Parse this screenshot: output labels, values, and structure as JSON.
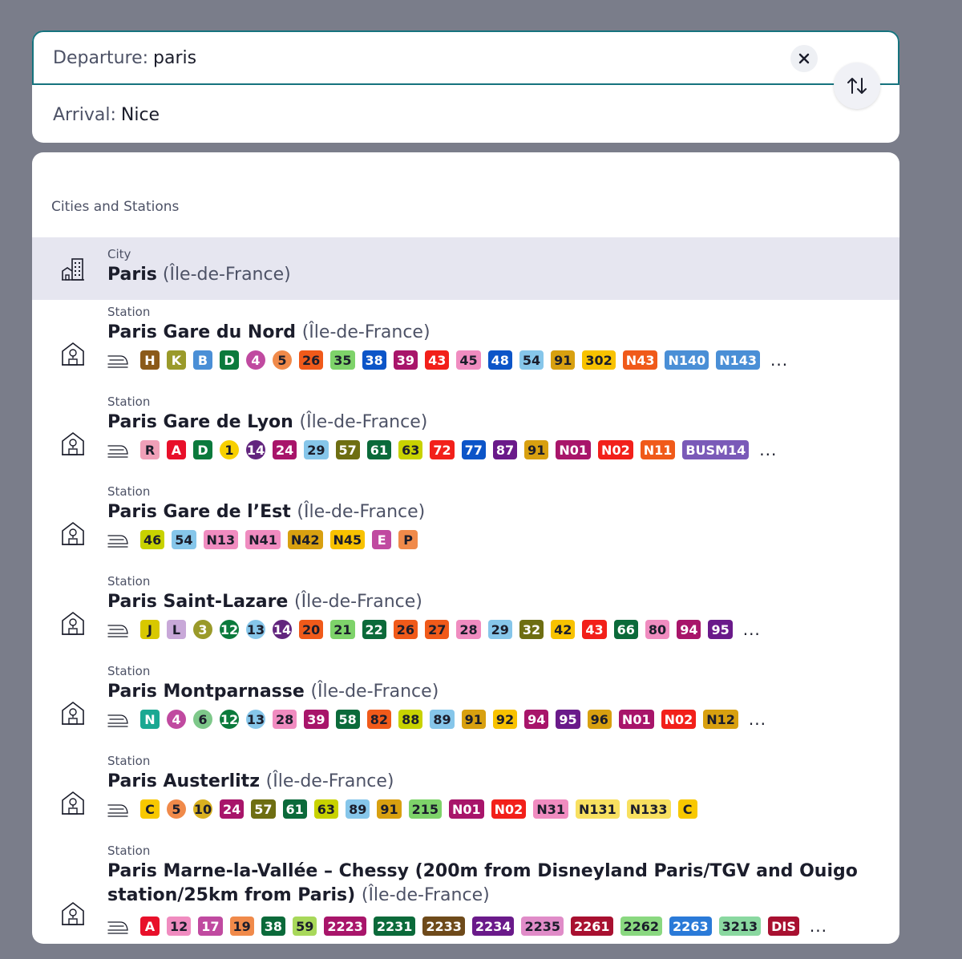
{
  "search": {
    "departure_label": "Departure:",
    "departure_value": "paris",
    "arrival_label": "Arrival:",
    "arrival_value": "Nice",
    "clear_icon": "close-icon",
    "swap_icon": "swap-vertical-icon"
  },
  "results": {
    "section_title": "Cities and Stations",
    "city": {
      "type": "City",
      "name": "Paris",
      "region": "(Île-de-France)",
      "icon": "city-icon"
    },
    "stations": [
      {
        "type": "Station",
        "name": "Paris Gare du Nord",
        "region": "(Île-de-France)",
        "more": "...",
        "lines": [
          {
            "t": "H",
            "bg": "#8b5a1a",
            "fg": "#ffffff"
          },
          {
            "t": "K",
            "bg": "#9a9a2a",
            "fg": "#ffffff"
          },
          {
            "t": "B",
            "bg": "#4a8fd6",
            "fg": "#ffffff"
          },
          {
            "t": "D",
            "bg": "#0b7a3c",
            "fg": "#ffffff"
          },
          {
            "t": "4",
            "bg": "#c04aa0",
            "fg": "#ffffff",
            "shape": "circle"
          },
          {
            "t": "5",
            "bg": "#f08a4a",
            "fg": "#1b1d2b",
            "shape": "circle"
          },
          {
            "t": "26",
            "bg": "#f05a1a",
            "fg": "#1b1d2b"
          },
          {
            "t": "35",
            "bg": "#7ed36a",
            "fg": "#1b1d2b"
          },
          {
            "t": "38",
            "bg": "#0c55c8",
            "fg": "#ffffff"
          },
          {
            "t": "39",
            "bg": "#a8156a",
            "fg": "#ffffff"
          },
          {
            "t": "43",
            "bg": "#f2201a",
            "fg": "#ffffff"
          },
          {
            "t": "45",
            "bg": "#f08cc0",
            "fg": "#1b1d2b"
          },
          {
            "t": "48",
            "bg": "#0c55c8",
            "fg": "#ffffff"
          },
          {
            "t": "54",
            "bg": "#86c6ea",
            "fg": "#1b1d2b"
          },
          {
            "t": "91",
            "bg": "#d8a010",
            "fg": "#1b1d2b"
          },
          {
            "t": "302",
            "bg": "#f8c200",
            "fg": "#1b1d2b"
          },
          {
            "t": "N43",
            "bg": "#f05a1a",
            "fg": "#ffffff"
          },
          {
            "t": "N140",
            "bg": "#4a8fd6",
            "fg": "#ffffff"
          },
          {
            "t": "N143",
            "bg": "#4a8fd6",
            "fg": "#ffffff"
          }
        ]
      },
      {
        "type": "Station",
        "name": "Paris Gare de Lyon",
        "region": "(Île-de-France)",
        "more": "...",
        "lines": [
          {
            "t": "R",
            "bg": "#f0a0b8",
            "fg": "#1b1d2b"
          },
          {
            "t": "A",
            "bg": "#e8102a",
            "fg": "#ffffff"
          },
          {
            "t": "D",
            "bg": "#0b7a3c",
            "fg": "#ffffff"
          },
          {
            "t": "1",
            "bg": "#f8d000",
            "fg": "#1b1d2b",
            "shape": "circle"
          },
          {
            "t": "14",
            "bg": "#62257e",
            "fg": "#ffffff",
            "shape": "circle"
          },
          {
            "t": "24",
            "bg": "#a8156a",
            "fg": "#ffffff"
          },
          {
            "t": "29",
            "bg": "#86c6ea",
            "fg": "#1b1d2b"
          },
          {
            "t": "57",
            "bg": "#6e6e12",
            "fg": "#ffffff"
          },
          {
            "t": "61",
            "bg": "#0b6a3a",
            "fg": "#ffffff"
          },
          {
            "t": "63",
            "bg": "#c8d200",
            "fg": "#1b1d2b"
          },
          {
            "t": "72",
            "bg": "#f2201a",
            "fg": "#ffffff"
          },
          {
            "t": "77",
            "bg": "#0c55c8",
            "fg": "#ffffff"
          },
          {
            "t": "87",
            "bg": "#6a1a8a",
            "fg": "#ffffff"
          },
          {
            "t": "91",
            "bg": "#d8a010",
            "fg": "#1b1d2b"
          },
          {
            "t": "N01",
            "bg": "#a8156a",
            "fg": "#ffffff"
          },
          {
            "t": "N02",
            "bg": "#f2201a",
            "fg": "#ffffff"
          },
          {
            "t": "N11",
            "bg": "#f05a1a",
            "fg": "#ffffff"
          },
          {
            "t": "BUSM14",
            "bg": "#7a5ab8",
            "fg": "#ffffff"
          }
        ]
      },
      {
        "type": "Station",
        "name": "Paris Gare de l’Est",
        "region": "(Île-de-France)",
        "more": "",
        "lines": [
          {
            "t": "46",
            "bg": "#c8d200",
            "fg": "#1b1d2b"
          },
          {
            "t": "54",
            "bg": "#86c6ea",
            "fg": "#1b1d2b"
          },
          {
            "t": "N13",
            "bg": "#f08cc0",
            "fg": "#1b1d2b"
          },
          {
            "t": "N41",
            "bg": "#f08cc0",
            "fg": "#1b1d2b"
          },
          {
            "t": "N42",
            "bg": "#d8a010",
            "fg": "#1b1d2b"
          },
          {
            "t": "N45",
            "bg": "#f8c200",
            "fg": "#1b1d2b"
          },
          {
            "t": "E",
            "bg": "#c04aa0",
            "fg": "#ffffff"
          },
          {
            "t": "P",
            "bg": "#f08a4a",
            "fg": "#1b1d2b"
          }
        ]
      },
      {
        "type": "Station",
        "name": "Paris Saint-Lazare",
        "region": "(Île-de-France)",
        "more": "...",
        "lines": [
          {
            "t": "J",
            "bg": "#d8c800",
            "fg": "#1b1d2b"
          },
          {
            "t": "L",
            "bg": "#c8a8d8",
            "fg": "#1b1d2b"
          },
          {
            "t": "3",
            "bg": "#9a9a2a",
            "fg": "#ffffff",
            "shape": "circle"
          },
          {
            "t": "12",
            "bg": "#0b7a3c",
            "fg": "#ffffff",
            "shape": "circle"
          },
          {
            "t": "13",
            "bg": "#86c6ea",
            "fg": "#1b1d2b",
            "shape": "circle"
          },
          {
            "t": "14",
            "bg": "#62257e",
            "fg": "#ffffff",
            "shape": "circle"
          },
          {
            "t": "20",
            "bg": "#f05a1a",
            "fg": "#1b1d2b"
          },
          {
            "t": "21",
            "bg": "#7ed36a",
            "fg": "#1b1d2b"
          },
          {
            "t": "22",
            "bg": "#0b6a3a",
            "fg": "#ffffff"
          },
          {
            "t": "26",
            "bg": "#f05a1a",
            "fg": "#1b1d2b"
          },
          {
            "t": "27",
            "bg": "#f05a1a",
            "fg": "#1b1d2b"
          },
          {
            "t": "28",
            "bg": "#f08cc0",
            "fg": "#1b1d2b"
          },
          {
            "t": "29",
            "bg": "#86c6ea",
            "fg": "#1b1d2b"
          },
          {
            "t": "32",
            "bg": "#6e6e12",
            "fg": "#ffffff"
          },
          {
            "t": "42",
            "bg": "#f8c200",
            "fg": "#1b1d2b"
          },
          {
            "t": "43",
            "bg": "#f2201a",
            "fg": "#ffffff"
          },
          {
            "t": "66",
            "bg": "#0b6a3a",
            "fg": "#ffffff"
          },
          {
            "t": "80",
            "bg": "#f08cc0",
            "fg": "#1b1d2b"
          },
          {
            "t": "94",
            "bg": "#a8156a",
            "fg": "#ffffff"
          },
          {
            "t": "95",
            "bg": "#6a1a8a",
            "fg": "#ffffff"
          }
        ]
      },
      {
        "type": "Station",
        "name": "Paris Montparnasse",
        "region": "(Île-de-France)",
        "more": "...",
        "lines": [
          {
            "t": "N",
            "bg": "#1aa892",
            "fg": "#ffffff"
          },
          {
            "t": "4",
            "bg": "#c04aa0",
            "fg": "#ffffff",
            "shape": "circle"
          },
          {
            "t": "6",
            "bg": "#7ec88a",
            "fg": "#1b1d2b",
            "shape": "circle"
          },
          {
            "t": "12",
            "bg": "#0b7a3c",
            "fg": "#ffffff",
            "shape": "circle"
          },
          {
            "t": "13",
            "bg": "#86c6ea",
            "fg": "#1b1d2b",
            "shape": "circle"
          },
          {
            "t": "28",
            "bg": "#f08cc0",
            "fg": "#1b1d2b"
          },
          {
            "t": "39",
            "bg": "#a8156a",
            "fg": "#ffffff"
          },
          {
            "t": "58",
            "bg": "#0b6a3a",
            "fg": "#ffffff"
          },
          {
            "t": "82",
            "bg": "#f05a1a",
            "fg": "#1b1d2b"
          },
          {
            "t": "88",
            "bg": "#c8d200",
            "fg": "#1b1d2b"
          },
          {
            "t": "89",
            "bg": "#86c6ea",
            "fg": "#1b1d2b"
          },
          {
            "t": "91",
            "bg": "#d8a010",
            "fg": "#1b1d2b"
          },
          {
            "t": "92",
            "bg": "#f8c200",
            "fg": "#1b1d2b"
          },
          {
            "t": "94",
            "bg": "#a8156a",
            "fg": "#ffffff"
          },
          {
            "t": "95",
            "bg": "#6a1a8a",
            "fg": "#ffffff"
          },
          {
            "t": "96",
            "bg": "#d8a010",
            "fg": "#1b1d2b"
          },
          {
            "t": "N01",
            "bg": "#a8156a",
            "fg": "#ffffff"
          },
          {
            "t": "N02",
            "bg": "#f2201a",
            "fg": "#ffffff"
          },
          {
            "t": "N12",
            "bg": "#d8a010",
            "fg": "#1b1d2b"
          }
        ]
      },
      {
        "type": "Station",
        "name": "Paris Austerlitz",
        "region": "(Île-de-France)",
        "more": "",
        "lines": [
          {
            "t": "C",
            "bg": "#f8c800",
            "fg": "#1b1d2b"
          },
          {
            "t": "5",
            "bg": "#f08a4a",
            "fg": "#1b1d2b",
            "shape": "circle"
          },
          {
            "t": "10",
            "bg": "#d8b020",
            "fg": "#1b1d2b",
            "shape": "circle"
          },
          {
            "t": "24",
            "bg": "#a8156a",
            "fg": "#ffffff"
          },
          {
            "t": "57",
            "bg": "#6e6e12",
            "fg": "#ffffff"
          },
          {
            "t": "61",
            "bg": "#0b6a3a",
            "fg": "#ffffff"
          },
          {
            "t": "63",
            "bg": "#c8d200",
            "fg": "#1b1d2b"
          },
          {
            "t": "89",
            "bg": "#86c6ea",
            "fg": "#1b1d2b"
          },
          {
            "t": "91",
            "bg": "#d8a010",
            "fg": "#1b1d2b"
          },
          {
            "t": "215",
            "bg": "#7ed36a",
            "fg": "#1b1d2b"
          },
          {
            "t": "N01",
            "bg": "#a8156a",
            "fg": "#ffffff"
          },
          {
            "t": "N02",
            "bg": "#f2201a",
            "fg": "#ffffff"
          },
          {
            "t": "N31",
            "bg": "#f08cc0",
            "fg": "#1b1d2b"
          },
          {
            "t": "N131",
            "bg": "#f8e060",
            "fg": "#1b1d2b"
          },
          {
            "t": "N133",
            "bg": "#f8e060",
            "fg": "#1b1d2b"
          },
          {
            "t": "C",
            "bg": "#f8c800",
            "fg": "#1b1d2b"
          }
        ]
      },
      {
        "type": "Station",
        "name": "Paris Marne-la-Vallée – Chessy (200m from Disneyland Paris/TGV and Ouigo",
        "name2": "station/25km from Paris)",
        "region": "(Île-de-France)",
        "more": "...",
        "lines": [
          {
            "t": "A",
            "bg": "#e8102a",
            "fg": "#ffffff"
          },
          {
            "t": "12",
            "bg": "#f08cc0",
            "fg": "#1b1d2b"
          },
          {
            "t": "17",
            "bg": "#c04aa0",
            "fg": "#ffffff"
          },
          {
            "t": "19",
            "bg": "#f08a4a",
            "fg": "#1b1d2b"
          },
          {
            "t": "38",
            "bg": "#0b6a3a",
            "fg": "#ffffff"
          },
          {
            "t": "59",
            "bg": "#a8d85a",
            "fg": "#1b1d2b"
          },
          {
            "t": "2223",
            "bg": "#a8156a",
            "fg": "#ffffff"
          },
          {
            "t": "2231",
            "bg": "#0b6a3a",
            "fg": "#ffffff"
          },
          {
            "t": "2233",
            "bg": "#6e4a1a",
            "fg": "#ffffff"
          },
          {
            "t": "2234",
            "bg": "#6a1a8a",
            "fg": "#ffffff"
          },
          {
            "t": "2235",
            "bg": "#e08cc8",
            "fg": "#1b1d2b"
          },
          {
            "t": "2261",
            "bg": "#a81030",
            "fg": "#ffffff"
          },
          {
            "t": "2262",
            "bg": "#8ad880",
            "fg": "#1b1d2b"
          },
          {
            "t": "2263",
            "bg": "#2a7ad8",
            "fg": "#ffffff"
          },
          {
            "t": "3213",
            "bg": "#8ad8a0",
            "fg": "#1b1d2b"
          },
          {
            "t": "DIS",
            "bg": "#a81030",
            "fg": "#ffffff"
          }
        ]
      }
    ]
  }
}
